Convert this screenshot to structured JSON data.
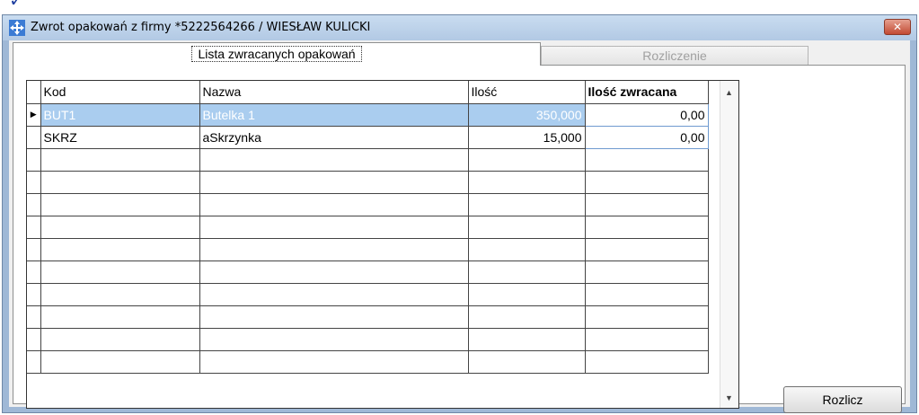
{
  "window": {
    "title": "Zwrot opakowań z firmy *5222564266 / WIESŁAW KULICKI",
    "close_label": "✕"
  },
  "tabs": [
    {
      "label": "Lista zwracanych opakowań",
      "active": true
    },
    {
      "label": "Rozliczenie",
      "active": false
    }
  ],
  "grid": {
    "columns": [
      "Kod",
      "Nazwa",
      "Ilość",
      "Ilość zwracana"
    ],
    "rows": [
      {
        "kod": "BUT1",
        "nazwa": "Butelka 1",
        "ilosc": "350,000",
        "ilosc_zwracana": "0,00",
        "selected": true
      },
      {
        "kod": "SKRZ",
        "nazwa": "aSkrzynka",
        "ilosc": "15,000",
        "ilosc_zwracana": "0,00",
        "selected": false
      }
    ],
    "empty_rows": 10,
    "row_indicator": "▶"
  },
  "buttons": {
    "rozlicz": "Rozlicz"
  },
  "colors": {
    "selected_row": "#aacdef",
    "window_border": "#9fb8d6",
    "close_button": "#c24a33"
  }
}
